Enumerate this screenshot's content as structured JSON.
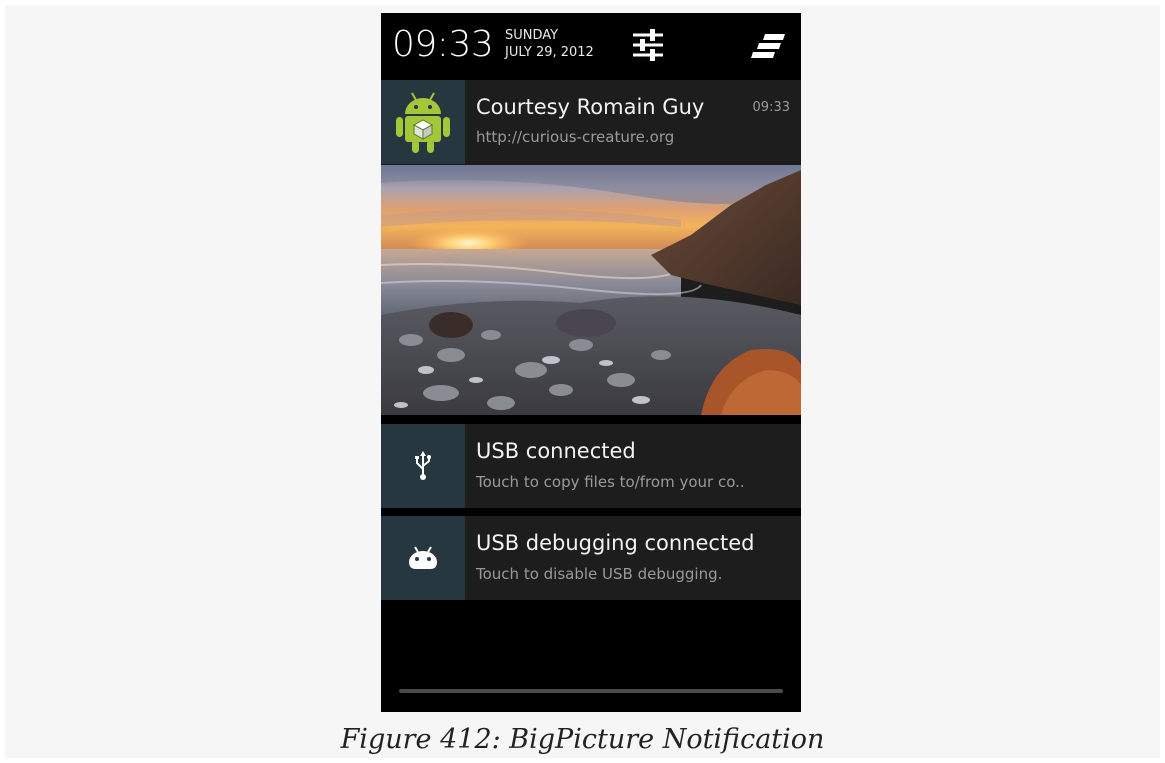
{
  "status_header": {
    "time": "09:33",
    "day": "SUNDAY",
    "date": "JULY 29, 2012",
    "settings_icon": "quick-settings-sliders-icon",
    "clear_icon": "clear-all-notifications-icon"
  },
  "notifications": [
    {
      "title": "Courtesy Romain Guy",
      "subtitle": "http://curious-creature.org",
      "time": "09:33",
      "icon": "android-robot-app-icon",
      "big_picture": "coastal-sunset-photo"
    },
    {
      "title": "USB connected",
      "subtitle": "Touch to copy files to/from your co..",
      "icon": "usb-icon"
    },
    {
      "title": "USB debugging connected",
      "subtitle": "Touch to disable USB debugging.",
      "icon": "android-debug-icon"
    }
  ],
  "caption": "Figure 412: BigPicture Notification",
  "colors": {
    "page_background": "#f6f6f6",
    "shade_background": "#000000",
    "notification_background": "#1d1d1d",
    "icon_tile_background": "#26373f",
    "android_green": "#a4c639"
  }
}
